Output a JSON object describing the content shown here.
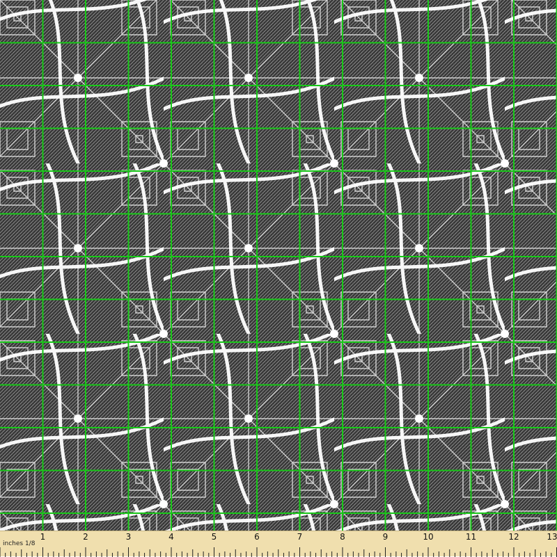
{
  "product": {
    "name": "Fabric swatch with measuring ruler",
    "pattern_icon": "geometric-lace-pattern",
    "colors": {
      "background": "#2f2f2f",
      "thread": "#f4f4f4",
      "grid": "#18c818",
      "ruler": "#f0dfae"
    }
  },
  "ruler": {
    "unit_label": "inches 1/8",
    "numbers": [
      "1",
      "2",
      "3",
      "4",
      "5",
      "6",
      "7",
      "8",
      "9",
      "10",
      "11",
      "12",
      "13"
    ]
  }
}
